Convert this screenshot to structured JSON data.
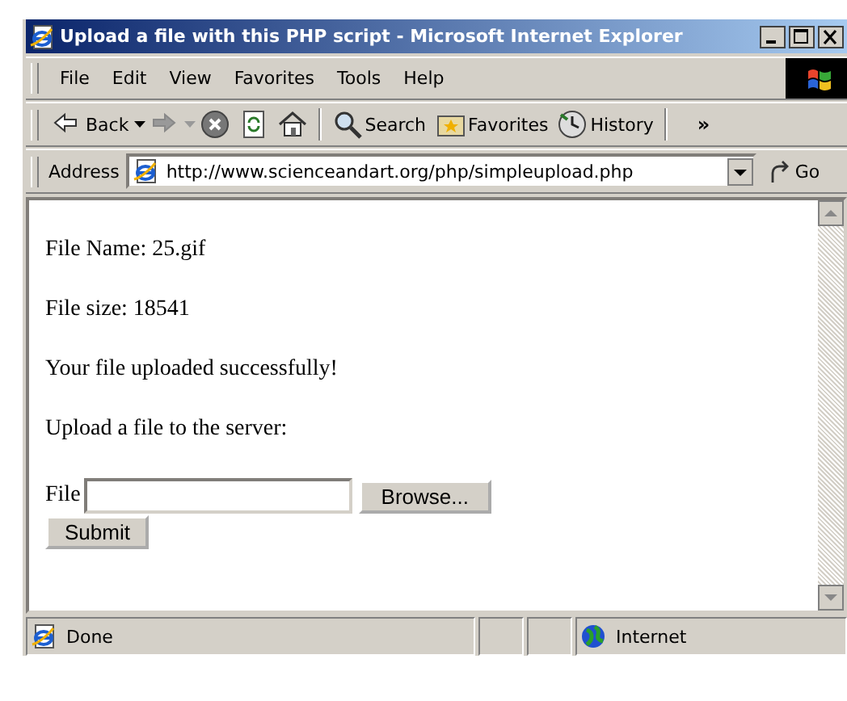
{
  "window": {
    "title": "Upload a file with this PHP script - Microsoft Internet Explorer"
  },
  "menu": [
    "File",
    "Edit",
    "View",
    "Favorites",
    "Tools",
    "Help"
  ],
  "toolbar": [
    {
      "kind": "back",
      "label": "Back"
    },
    {
      "kind": "forward"
    },
    {
      "kind": "stop"
    },
    {
      "kind": "refresh"
    },
    {
      "kind": "home"
    },
    {
      "kind": "search",
      "label": "Search"
    },
    {
      "kind": "favorites",
      "label": "Favorites"
    },
    {
      "kind": "history",
      "label": "History"
    }
  ],
  "overflow": "»",
  "address": {
    "label": "Address",
    "value": "http://www.scienceandart.org/php/simpleupload.php",
    "go": "Go"
  },
  "content": {
    "lines": [
      "File Name: 25.gif",
      "File size: 18541",
      "Your file uploaded successfully!",
      "Upload a file to the server:"
    ],
    "file_label": "File",
    "browse": "Browse...",
    "submit": "Submit"
  },
  "status_bar": {
    "text": "Done",
    "zone": "Internet"
  }
}
